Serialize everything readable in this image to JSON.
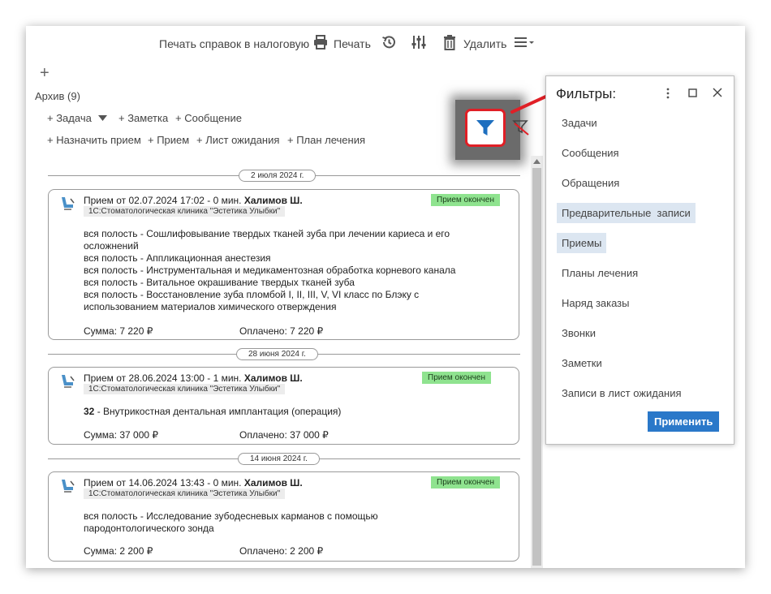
{
  "toolbar": {
    "tax_print_label": "Печать справок в налоговую",
    "print_label": "Печать",
    "delete_label": "Удалить"
  },
  "add_label": "+",
  "archive_label": "Архив (9)",
  "actions_row1": [
    {
      "label": "+ Задача"
    },
    {
      "label": "+ Заметка"
    },
    {
      "label": "+ Сообщение"
    }
  ],
  "actions_row2": [
    {
      "label": "+ Назначить прием"
    },
    {
      "label": "+ Прием"
    },
    {
      "label": "+ Лист ожидания"
    },
    {
      "label": "+ План лечения"
    }
  ],
  "records": [
    {
      "date": "2 июля 2024 г.",
      "title_prefix": "Прием от 02.07.2024 17:02 - 0 мин. ",
      "doctor": "Халимов Ш.",
      "clinic": "1С:Стоматологическая клиника \"Эстетика Улыбки\"",
      "status": "Прием окончен",
      "lines": [
        "вся полость - Сошлифовывание твердых тканей зуба при лечении кариеса и его",
        "осложнений",
        "вся полость - Аппликационная анестезия",
        "вся полость - Инструментальная и медикаментозная обработка корневого канала",
        "вся полость - Витальное окрашивание твердых тканей зуба",
        "вся полость - Восстановление зуба пломбой I, II, III, V, VI класс по Блэку с",
        "использованием материалов химического отверждения"
      ],
      "sum": "Сумма: 7 220 ₽",
      "paid": "Оплачено: 7 220 ₽"
    },
    {
      "date": "28 июня 2024 г.",
      "title_prefix": "Прием от 28.06.2024 13:00 - 1 мин. ",
      "doctor": "Халимов Ш.",
      "clinic": "1С:Стоматологическая клиника \"Эстетика Улыбки\"",
      "status": "Прием окончен",
      "line_bold": "32",
      "line_rest": " - Внутрикостная дентальная имплантация (операция)",
      "sum": "Сумма: 37 000 ₽",
      "paid": "Оплачено: 37 000 ₽"
    },
    {
      "date": "14 июня 2024 г.",
      "title_prefix": "Прием от 14.06.2024 13:43 - 0 мин. ",
      "doctor": "Халимов Ш.",
      "clinic": "1С:Стоматологическая клиника \"Эстетика Улыбки\"",
      "status": "Прием окончен",
      "lines": [
        "вся полость - Исследование зубодесневых карманов с помощью",
        "пародонтологического зонда"
      ],
      "sum": "Сумма: 2 200 ₽",
      "paid": "Оплачено: 2 200 ₽"
    }
  ],
  "filters": {
    "title": "Фильтры:",
    "items": [
      {
        "label": "Задачи"
      },
      {
        "label": "Сообщения"
      },
      {
        "label": "Обращения"
      },
      {
        "label": "Предварительные  записи"
      },
      {
        "label": "Приемы"
      },
      {
        "label": "Планы лечения"
      },
      {
        "label": "Наряд заказы"
      },
      {
        "label": "Звонки"
      },
      {
        "label": "Заметки"
      },
      {
        "label": "Записи в лист ожидания"
      }
    ],
    "apply_label": "Применить"
  },
  "colors": {
    "accent": "#2a78c9",
    "annotation_red": "#e01f26",
    "status_green": "#8fe38f",
    "selected_filter": "#dce6f1"
  }
}
